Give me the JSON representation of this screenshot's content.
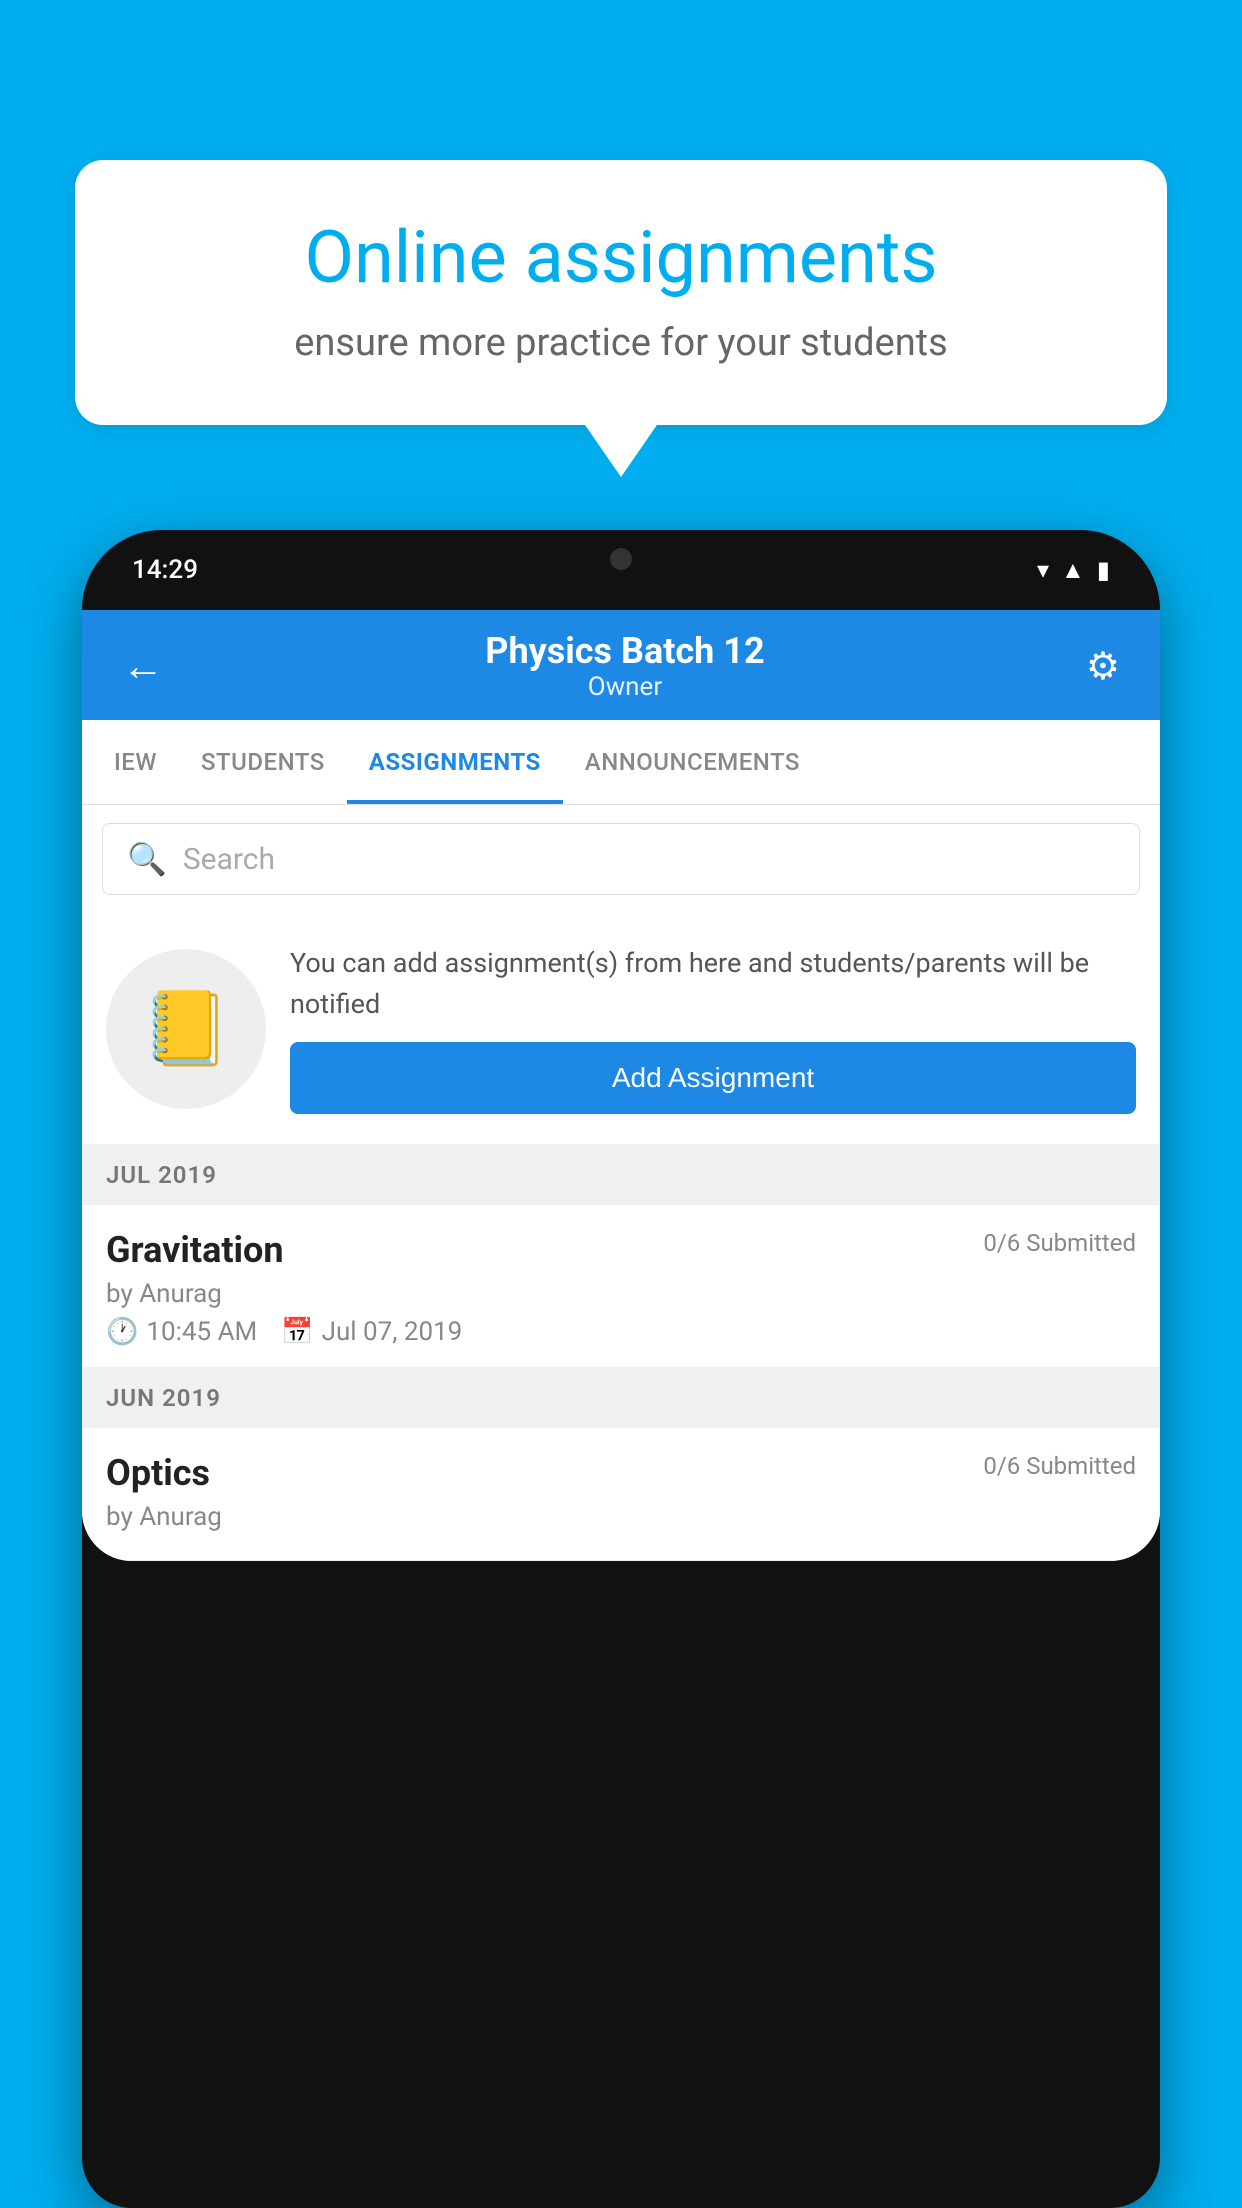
{
  "background_color": "#00AEEF",
  "bubble": {
    "title": "Online assignments",
    "subtitle": "ensure more practice for your students"
  },
  "phone": {
    "status_bar": {
      "time": "14:29",
      "wifi": "▾",
      "signal": "▲",
      "battery": "▮"
    },
    "header": {
      "title": "Physics Batch 12",
      "subtitle": "Owner",
      "back_label": "←",
      "settings_label": "⚙"
    },
    "tabs": [
      {
        "label": "IEW",
        "active": false
      },
      {
        "label": "STUDENTS",
        "active": false
      },
      {
        "label": "ASSIGNMENTS",
        "active": true
      },
      {
        "label": "ANNOUNCEMENTS",
        "active": false
      }
    ],
    "search": {
      "placeholder": "Search"
    },
    "promo": {
      "text": "You can add assignment(s) from here and students/parents will be notified",
      "button_label": "Add Assignment"
    },
    "sections": [
      {
        "month_label": "JUL 2019",
        "assignments": [
          {
            "title": "Gravitation",
            "submitted": "0/6 Submitted",
            "by": "by Anurag",
            "time": "10:45 AM",
            "date": "Jul 07, 2019"
          }
        ]
      },
      {
        "month_label": "JUN 2019",
        "assignments": [
          {
            "title": "Optics",
            "submitted": "0/6 Submitted",
            "by": "by Anurag",
            "time": "",
            "date": ""
          }
        ]
      }
    ]
  }
}
